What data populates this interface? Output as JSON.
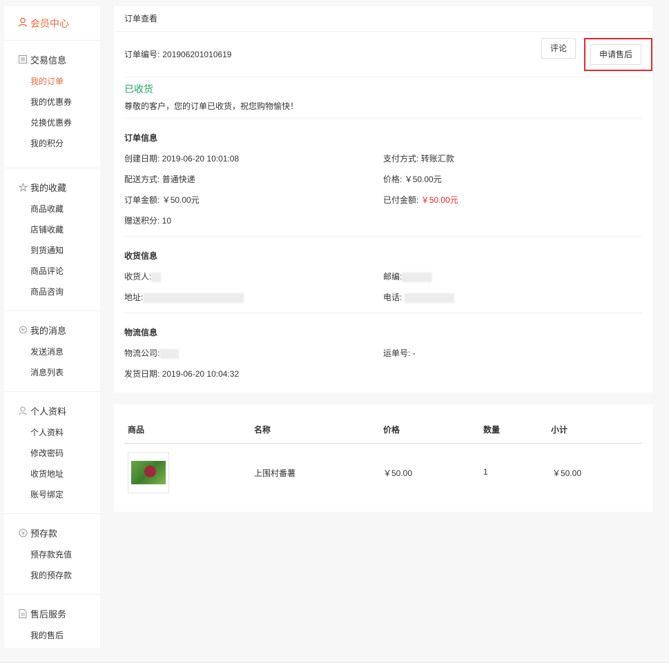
{
  "sidebar": {
    "head": "会员中心",
    "groups": [
      {
        "title": "交易信息",
        "icon": "list-icon",
        "items": [
          "我的订单",
          "我的优惠券",
          "兑换优惠券",
          "我的积分"
        ]
      },
      {
        "title": "我的收藏",
        "icon": "star-icon",
        "items": [
          "商品收藏",
          "店铺收藏",
          "到货通知",
          "商品评论",
          "商品咨询"
        ]
      },
      {
        "title": "我的消息",
        "icon": "message-icon",
        "items": [
          "发送消息",
          "消息列表"
        ]
      },
      {
        "title": "个人资料",
        "icon": "user-icon",
        "items": [
          "个人资料",
          "修改密码",
          "收货地址",
          "账号绑定"
        ]
      },
      {
        "title": "预存款",
        "icon": "yen-icon",
        "items": [
          "预存款充值",
          "我的预存款"
        ]
      },
      {
        "title": "售后服务",
        "icon": "document-icon",
        "items": [
          "我的售后"
        ]
      }
    ]
  },
  "panel": {
    "title": "订单查看",
    "order_no_label": "订单编号:",
    "order_no": "201906201010619",
    "review_button": "评论",
    "after_sale_button": "申请售后",
    "status": "已收货",
    "status_msg": "尊敬的客户，您的订单已收货，祝您购物愉快！"
  },
  "order_info": {
    "title": "订单信息",
    "created_label": "创建日期:",
    "created": "2019-06-20 10:01:08",
    "pay_method_label": "支付方式:",
    "pay_method": "转账汇款",
    "shipping_label": "配送方式:",
    "shipping": "普通快递",
    "price_label": "价格:",
    "price": "￥50.00元",
    "amount_label": "订单金额:",
    "amount": "￥50.00元",
    "paid_label": "已付金额:",
    "paid": "￥50.00元",
    "points_label": "赠送积分:",
    "points": "10"
  },
  "receiver_info": {
    "title": "收货信息",
    "receiver_label": "收货人:",
    "zip_label": "邮编:",
    "address_label": "地址:",
    "phone_label": "电话:"
  },
  "logistics_info": {
    "title": "物流信息",
    "company_label": "物流公司:",
    "tracking_label": "运单号:",
    "tracking": "-",
    "ship_date_label": "发货日期:",
    "ship_date": "2019-06-20 10:04:32"
  },
  "goods": {
    "headers": [
      "商品",
      "名称",
      "价格",
      "数量",
      "小计"
    ],
    "row": {
      "name": "上围村番薯",
      "price": "￥50.00",
      "qty": "1",
      "subtotal": "￥50.00"
    }
  },
  "colors": {
    "accent": "#e4693b",
    "status": "#27a061",
    "alert": "#e4262b"
  }
}
